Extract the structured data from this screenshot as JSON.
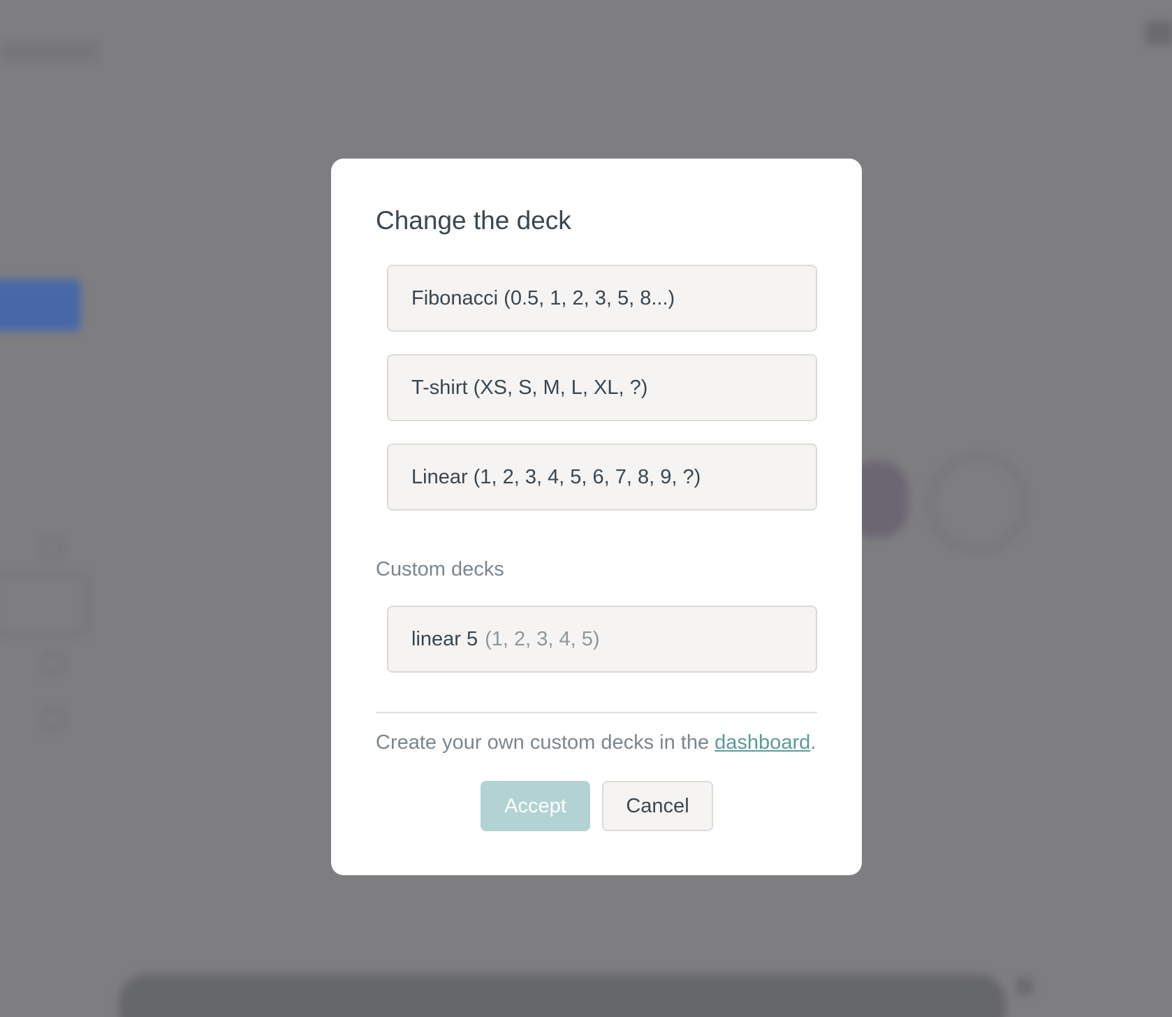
{
  "modal": {
    "title": "Change the deck",
    "decks": [
      {
        "label": "Fibonacci (0.5, 1, 2, 3, 5, 8...)"
      },
      {
        "label": "T-shirt (XS, S, M, L, XL, ?)"
      },
      {
        "label": "Linear (1, 2, 3, 4, 5, 6, 7, 8, 9, ?)"
      }
    ],
    "custom_section_label": "Custom decks",
    "custom_decks": [
      {
        "name": "linear 5",
        "values": "(1, 2, 3, 4, 5)"
      }
    ],
    "footnote": {
      "prefix": "Create your own custom decks in the ",
      "link_text": "dashboard",
      "suffix": "."
    },
    "buttons": {
      "accept": "Accept",
      "cancel": "Cancel"
    }
  },
  "colors": {
    "overlay": "#7e7e80",
    "accept_disabled": "#b3d2d3",
    "link": "#5a9b98",
    "text": "#3a4650"
  }
}
